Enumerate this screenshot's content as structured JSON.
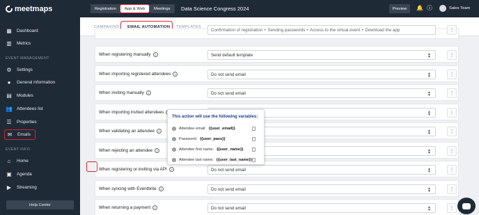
{
  "app": {
    "logo": "meetmaps",
    "event_title": "Data Science Congress 2024",
    "team": "Sales Team"
  },
  "colors": {
    "sidebar": "#1f2a37",
    "highlight": "#d8242b",
    "tooltip_title": "#1d3f8a"
  },
  "top_tabs": [
    {
      "label": "Registration",
      "active": false
    },
    {
      "label": "App & Web",
      "active": true
    },
    {
      "label": "Meetings",
      "active": false
    }
  ],
  "top_actions": {
    "preview": "Preview",
    "bell_icon": "bell-icon",
    "info_icon": "info-icon"
  },
  "sidebar": {
    "top_items": [
      {
        "label": "Dashboard",
        "icon": "dashboard-icon"
      },
      {
        "label": "Metrics",
        "icon": "chart-icon"
      }
    ],
    "event_management_label": "EVENT MANAGEMENT",
    "management_items": [
      {
        "label": "Settings",
        "icon": "gear-icon"
      },
      {
        "label": "General information",
        "icon": "info-icon"
      },
      {
        "label": "Modules",
        "icon": "modules-icon"
      },
      {
        "label": "Attendees list",
        "icon": "users-icon"
      },
      {
        "label": "Properties",
        "icon": "list-icon"
      },
      {
        "label": "Emails",
        "icon": "mail-icon",
        "active": true
      }
    ],
    "event_info_label": "EVENT INFO",
    "info_items": [
      {
        "label": "Home",
        "icon": "home-icon"
      },
      {
        "label": "Agenda",
        "icon": "calendar-icon"
      },
      {
        "label": "Streaming",
        "icon": "video-icon"
      }
    ],
    "help": "Help Center"
  },
  "subtabs": [
    {
      "label": "CAMPAIGNS",
      "active": false
    },
    {
      "label": "EMAIL AUTOMATION",
      "active": true
    },
    {
      "label": "TEMPLATES",
      "active": false
    }
  ],
  "rows": [
    {
      "label": "When registering manually",
      "value": "Send default template"
    },
    {
      "label": "When importing registered attendees",
      "value": "Do not send email"
    },
    {
      "label": "When inviting manually",
      "value": "Do not send email"
    },
    {
      "label": "When importing invited attendees",
      "value": ""
    },
    {
      "label": "When validating an attendee",
      "value": ""
    },
    {
      "label": "When rejecting an attendee",
      "value": ""
    },
    {
      "label": "When registering or inviting via API",
      "value": "Do not send email"
    },
    {
      "label": "When syncing with Eventbrite",
      "value": "Do not send email"
    },
    {
      "label": "When returning a payment",
      "value": "Do not send email"
    }
  ],
  "partial_top_row": {
    "value": "Confirmation of registration + Sending passwords + Access to the virtual event + Download the app"
  },
  "tooltip": {
    "title": "This action will use the following variables:",
    "variables": [
      {
        "label": "Attendee email:",
        "code": "{{user_email}}"
      },
      {
        "label": "Password:",
        "code": "{{user_pass}}"
      },
      {
        "label": "Attendee first name:",
        "code": "{{user_name}}"
      },
      {
        "label": "Attendee last name:",
        "code": "{{user_last_name}}"
      }
    ]
  }
}
